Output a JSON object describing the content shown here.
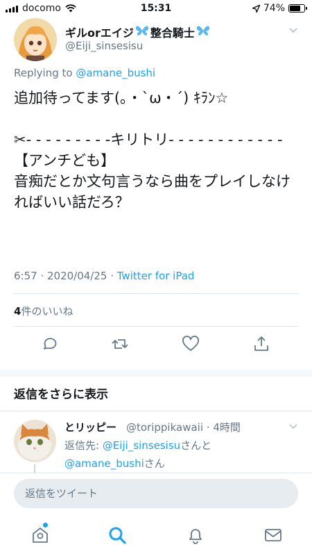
{
  "status_bar": {
    "carrier": "docomo",
    "time": "15:31",
    "battery": "74%",
    "battery_level": 0.74
  },
  "tweet": {
    "author_name": "ギルorエイジ",
    "author_suffix": "整合騎士",
    "author_handle": "@Eiji_sinsesisu",
    "replying_prefix": "Replying to ",
    "replying_to": "@amane_bushi",
    "text": "追加待ってます(｡・`ω・´) ｷﾗﾝ☆\n\n✂- - - - - - - - -キリトリ- - - - - - - - - - - -\n【アンチども】\n音痴だとか文句言うなら曲をプレイしなければいい話だろ？",
    "timestamp": "6:57 · 2020/04/25 · ",
    "source": "Twitter for iPad",
    "likes_count": "4",
    "likes_label": "件のいいね"
  },
  "more_replies_label": "返信をさらに表示",
  "reply": {
    "name": "とリッピー",
    "handle_time": "@torippikawaii · 4時間",
    "reply_to_prefix": "返信先: ",
    "reply_to_user1": "@Eiji_sinsesisu",
    "reply_to_mid": "さんと",
    "reply_to_user2": "@amane_bushi",
    "reply_to_suffix": "さん"
  },
  "composer": {
    "placeholder": "返信をツイート"
  },
  "icons": {
    "accent": "#1da1f2",
    "muted": "#657786",
    "names": [
      "home-icon",
      "search-icon",
      "notifications-icon",
      "messages-icon",
      "reply-icon",
      "retweet-icon",
      "like-icon",
      "share-icon"
    ]
  }
}
